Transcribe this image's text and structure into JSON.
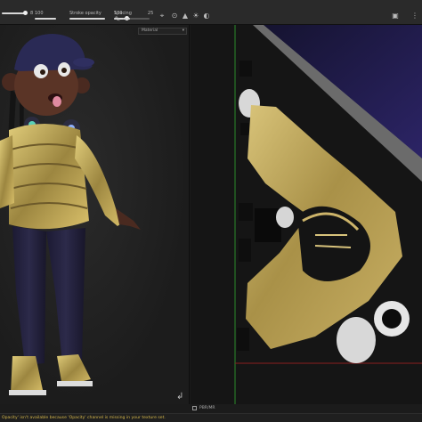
{
  "toolbar": {
    "size_value": "8",
    "flow_value": "100",
    "stroke_opacity_label": "Stroke opacity",
    "stroke_opacity_value": "100",
    "spacing_label": "Spacing",
    "spacing_value": "25",
    "icons": [
      "brush-icon",
      "symmetry-icon",
      "lazy-mouse-icon",
      "camera-icon",
      "light-icon",
      "display-settings-icon",
      "fullscreen-icon"
    ]
  },
  "viewport_left": {
    "material_dropdown": "Material"
  },
  "viewport_right": {
    "material_dropdown": "Material"
  },
  "statusbar": {
    "message": "Opacity' isn't available because 'Opacity' channel is missing in your texture set."
  },
  "mode": {
    "label": "PBR/MR"
  },
  "colors": {
    "gold": "#b8a35a",
    "navy_cap": "#2a2a55",
    "status_yellow": "#d6b84a",
    "axis_green": "#2c8a2c",
    "axis_red": "#8a2020"
  }
}
